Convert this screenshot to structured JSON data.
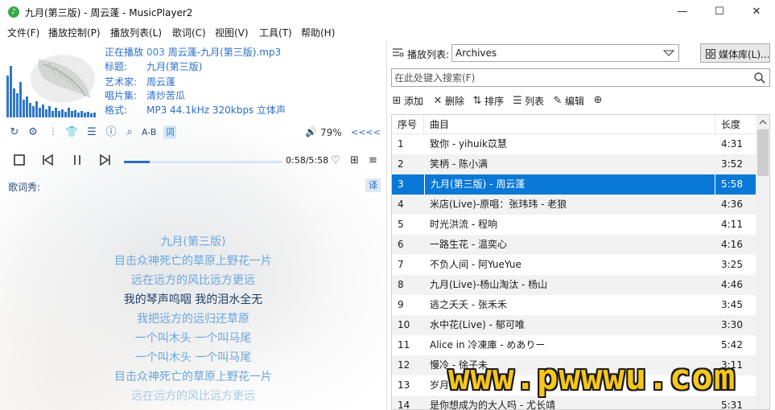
{
  "window": {
    "title": "九月(第三版) - 周云蓬 - MusicPlayer2",
    "minimize": "—",
    "maximize": "☐",
    "close": "✕"
  },
  "menu": [
    "文件(F)",
    "播放控制(P)",
    "播放列表(L)",
    "歌词(C)",
    "视图(V)",
    "工具(T)",
    "帮助(H)"
  ],
  "now_playing": {
    "label_playing": "正在播放",
    "index": "003",
    "file": "周云蓬-九月(第三版).mp3",
    "label_title": "标题:",
    "title": "九月(第三版)",
    "label_artist": "艺术家:",
    "artist": "周云蓬",
    "label_album": "唱片集:",
    "album": "清炒苦瓜",
    "label_format": "格式:",
    "format": "MP3 44.1kHz 320kbps 立体声"
  },
  "toolbar": {
    "ab_label": "A-B",
    "lyric_button": "词",
    "volume": "79%",
    "volume_arrows": "<<<<"
  },
  "playback": {
    "time": "0:58/5:58",
    "progress": 0.162
  },
  "lyrics": {
    "label": "歌词秀:",
    "translate_button": "译",
    "lines": [
      "九月(第三版)",
      "目击众神死亡的草原上野花一片",
      "远在远方的风比远方更远",
      "我的琴声呜咽 我的泪水全无",
      "我把远方的远归还草原",
      "一个叫木头 一个叫马尾",
      "一个叫木头 一个叫马尾",
      "目击众神死亡的草原上野花一片",
      "远在远方的风比远方更远"
    ],
    "current_line": 3
  },
  "playlist": {
    "label": "播放列表:",
    "selected": "Archives",
    "media_library_button": "媒体库(L)...",
    "search_placeholder": "在此处键入搜索(F)",
    "actions": [
      "添加",
      "删除",
      "排序",
      "列表",
      "编辑"
    ],
    "columns": [
      "序号",
      "曲目",
      "长度"
    ],
    "selected_row": 2,
    "rows": [
      {
        "no": "1",
        "title": "致你 - yihuik苡慧",
        "length": "4:31"
      },
      {
        "no": "2",
        "title": "笑柄 - 陈小满",
        "length": "3:52"
      },
      {
        "no": "3",
        "title": "九月(第三版) - 周云蓬",
        "length": "5:58"
      },
      {
        "no": "4",
        "title": "米店(Live)-原唱：张玮玮 - 老狼",
        "length": "4:36"
      },
      {
        "no": "5",
        "title": "时光洪流 - 程响",
        "length": "4:11"
      },
      {
        "no": "6",
        "title": "一路生花 - 温奕心",
        "length": "4:16"
      },
      {
        "no": "7",
        "title": "不负人间 - 阿YueYue",
        "length": "3:25"
      },
      {
        "no": "8",
        "title": "九月(Live)-杨山淘汰 - 杨山",
        "length": "4:46"
      },
      {
        "no": "9",
        "title": "逃之夭夭 - 张禾禾",
        "length": "3:45"
      },
      {
        "no": "10",
        "title": "水中花(Live) - 郁可唯",
        "length": "3:30"
      },
      {
        "no": "11",
        "title": "Alice in 冷凍庫 - めありー",
        "length": "5:42"
      },
      {
        "no": "12",
        "title": "慢冷 - 徐子未",
        "length": "3:11"
      },
      {
        "no": "13",
        "title": "岁月 - ",
        "length": ""
      },
      {
        "no": "14",
        "title": "是你想成为的大人吗 - 尤长靖",
        "length": "5:31"
      }
    ]
  },
  "watermark": "www.pwwwu.com"
}
